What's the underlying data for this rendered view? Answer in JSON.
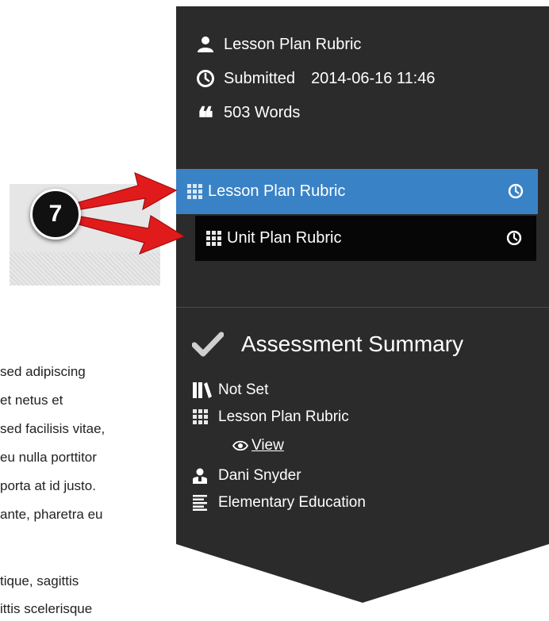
{
  "document": {
    "lines_a": [
      "sed adipiscing",
      "et netus et",
      "sed facilisis vitae,",
      "eu nulla porttitor",
      "porta at id justo.",
      "ante, pharetra eu"
    ],
    "lines_b": [
      "tique, sagittis",
      "ittis scelerisque"
    ]
  },
  "callout": {
    "step_number": "7"
  },
  "sidebar": {
    "meta": {
      "rubric_name": "Lesson Plan Rubric",
      "submitted_label": "Submitted",
      "submitted_value": "2014-06-16 11:46",
      "word_count": "503 Words"
    },
    "rubrics": [
      {
        "label": "Lesson Plan Rubric",
        "selected": true,
        "icon": "grid-icon"
      },
      {
        "label": "Unit Plan Rubric",
        "selected": false,
        "icon": "grid-icon"
      }
    ],
    "summary": {
      "title": "Assessment Summary",
      "status": "Not Set",
      "rubric": "Lesson Plan Rubric",
      "view_label": "View",
      "user": "Dani Snyder",
      "program": "Elementary Education"
    }
  },
  "colors": {
    "sidebar_bg": "#2b2b2b",
    "selected_bg": "#3a82c6",
    "child_bg": "#060606",
    "arrow_red": "#e11b1b"
  }
}
